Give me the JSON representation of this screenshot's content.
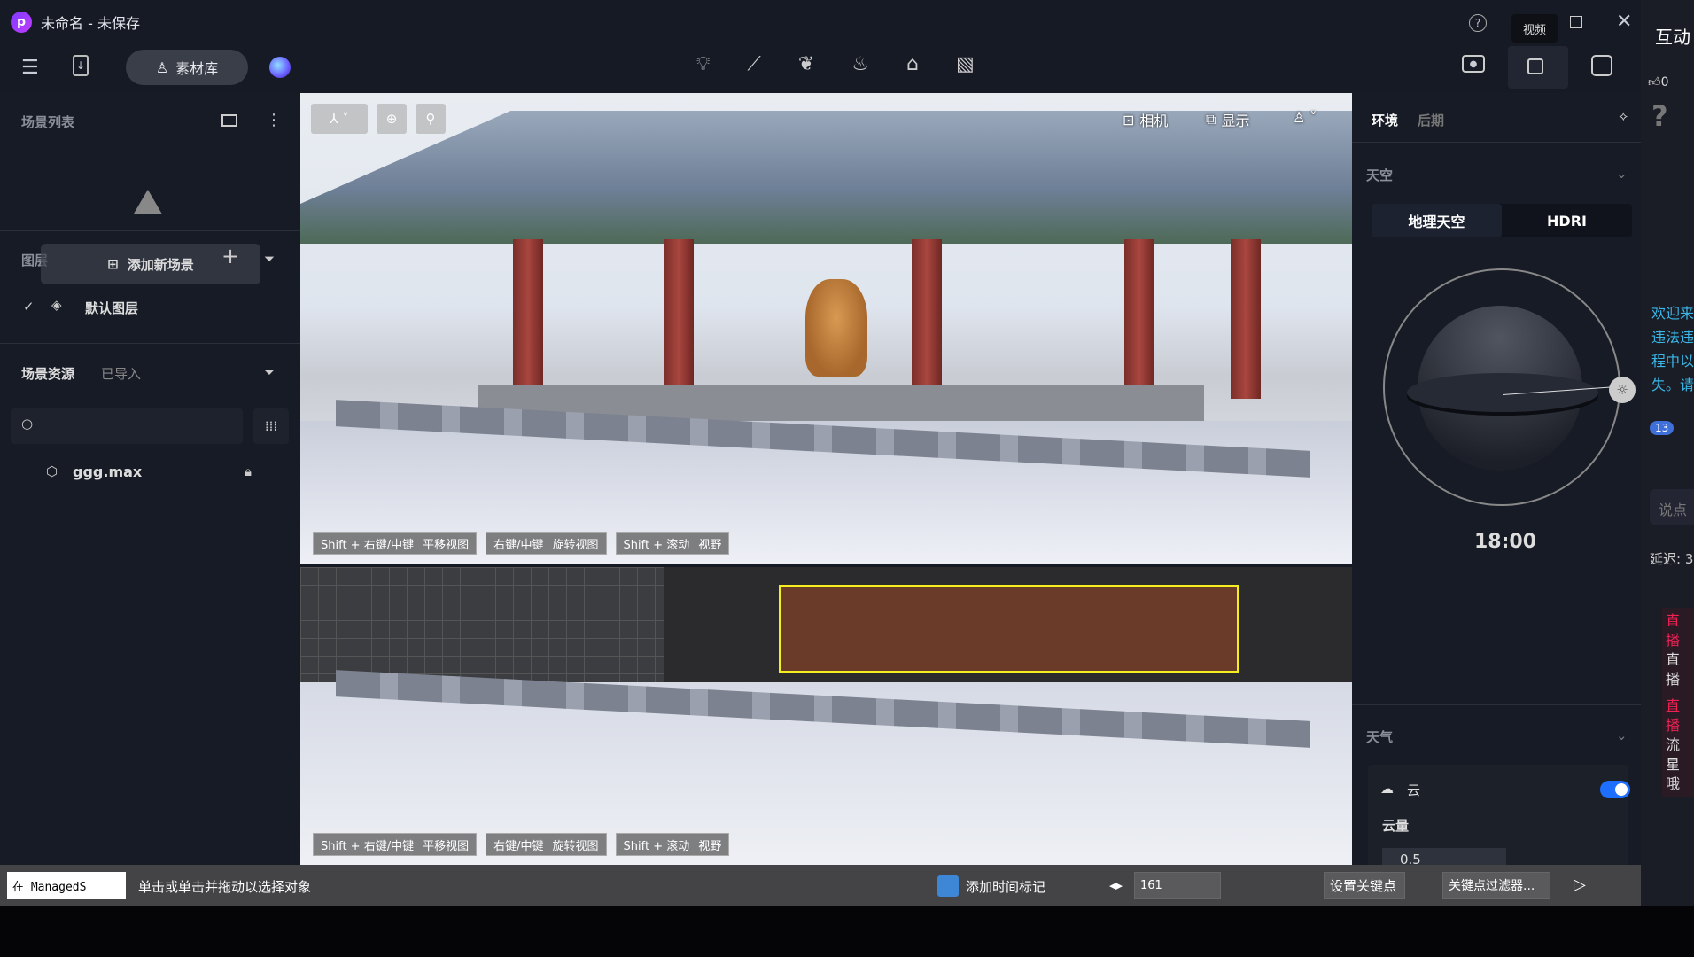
{
  "window": {
    "title": "未命名 - 未保存",
    "tooltip": "视频"
  },
  "toolbar": {
    "library_label": "素材库",
    "tools": [
      "bulb-icon",
      "path-icon",
      "leaf-icon",
      "fire-icon",
      "transform-icon",
      "hatch-icon"
    ],
    "right": [
      "camera-icon",
      "video-icon",
      "inbox-icon"
    ]
  },
  "left": {
    "scene_list": "场景列表",
    "add_scene": "添加新场景",
    "layers": "图层",
    "default_layer": "默认图层",
    "assets": "场景资源",
    "imported": "已导入",
    "search_placeholder": "",
    "file": "ggg.max"
  },
  "viewport": {
    "camera": "相机",
    "display": "显示",
    "hints": [
      {
        "k": "Shift + 右键/中键",
        "v": "平移视图"
      },
      {
        "k": "右键/中键",
        "v": "旋转视图"
      },
      {
        "k": "Shift + 滚动",
        "v": "视野"
      }
    ]
  },
  "right": {
    "tab_env": "环境",
    "tab_post": "后期",
    "sky": "天空",
    "geo_sky": "地理天空",
    "hdri": "HDRI",
    "time": "18:00",
    "weather": "天气",
    "cloud": "云",
    "cloud_on": true,
    "cloud_amount": "云量",
    "cloud_value": "0.5"
  },
  "strip": {
    "title": "互动",
    "likes": "0",
    "lines": [
      "欢迎来",
      "违法违",
      "程中以",
      "失。请"
    ],
    "badge": "13",
    "input": "说点",
    "delay": "延迟: 3",
    "live1": [
      "直播",
      "直播"
    ],
    "live2": [
      "直播",
      "流星",
      "哦"
    ]
  },
  "status": {
    "script": "在 ManagedS",
    "prompt": "单击或单击并拖动以选择对象",
    "add_time_tag": "添加时间标记",
    "frame": "161",
    "set_key": "设置关键点",
    "key_filter": "关键点过滤器..."
  },
  "colors": {
    "accent": "#1e6fff",
    "bg": "#171b25"
  }
}
